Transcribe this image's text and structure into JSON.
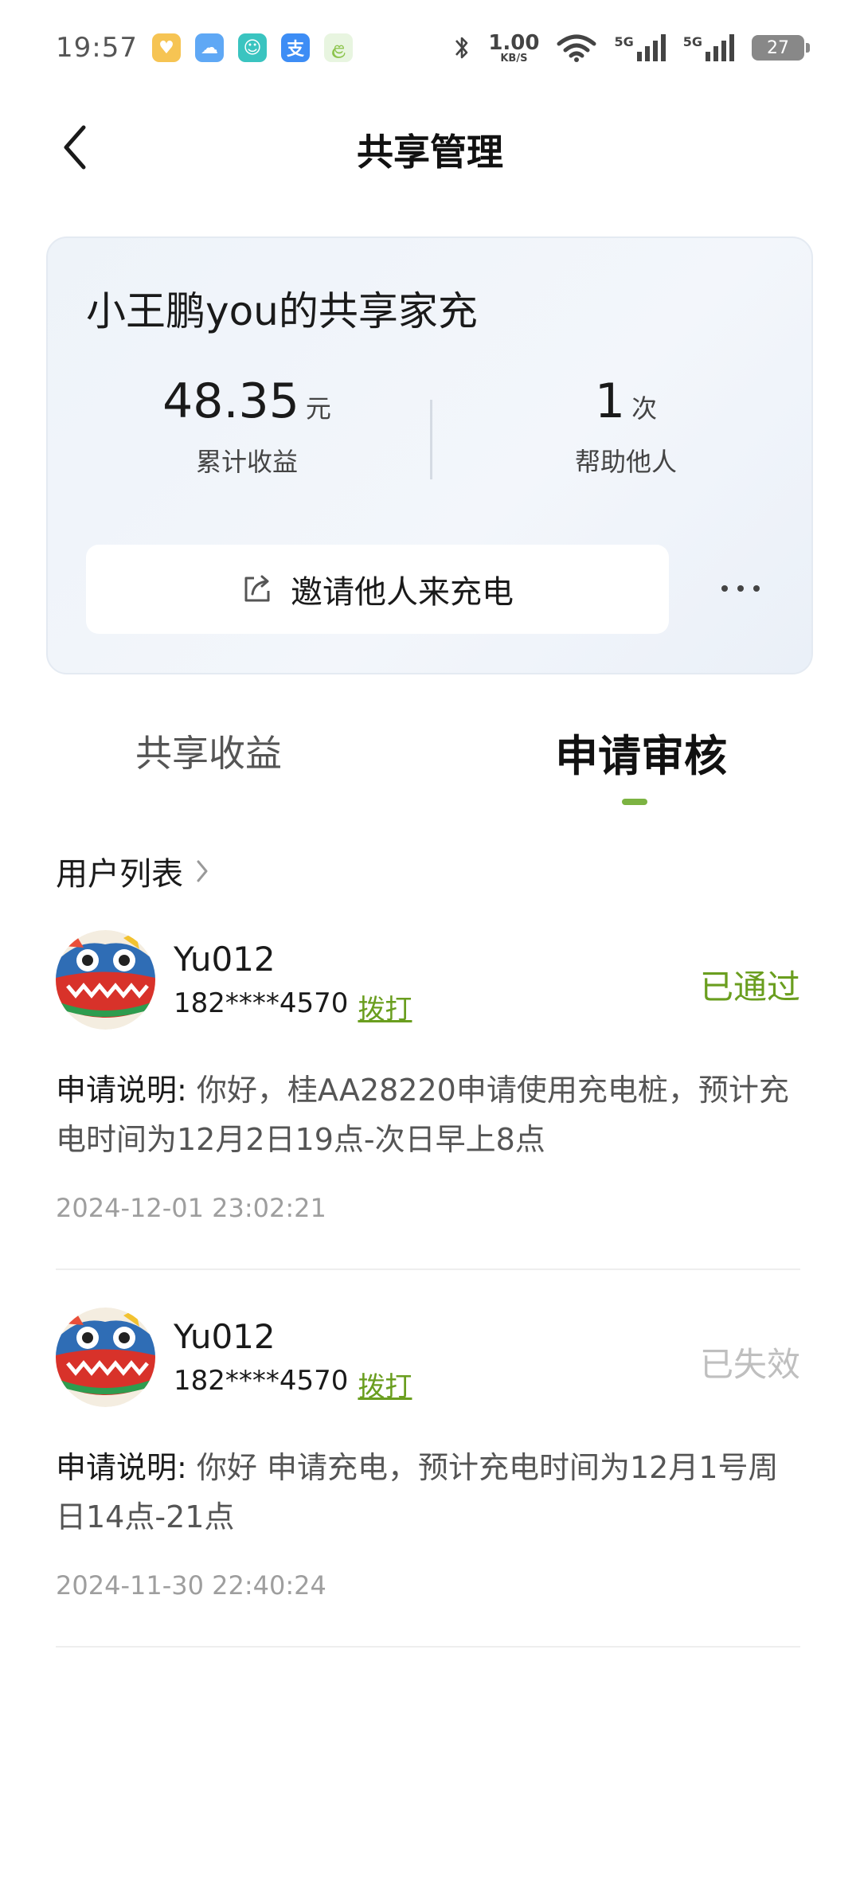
{
  "status_bar": {
    "time": "19:57",
    "app_icons": [
      {
        "name": "heart-app-icon",
        "color": "#f6c453",
        "glyph": "♥"
      },
      {
        "name": "cloud-app-icon",
        "color": "#5fa8f5",
        "glyph": "☁"
      },
      {
        "name": "cat-app-icon",
        "color": "#3ac4c0",
        "glyph": "☺"
      },
      {
        "name": "alipay-app-icon",
        "color": "#3d8df5",
        "glyph": "支"
      },
      {
        "name": "leaf-app-icon",
        "color": "#8bc34a",
        "glyph": "ළ"
      }
    ],
    "network_speed_value": "1.00",
    "network_speed_unit": "KB/S",
    "signal_label_1": "5G",
    "signal_label_2": "5G",
    "battery": "27"
  },
  "header": {
    "title": "共享管理"
  },
  "summary_card": {
    "title": "小王鹏you的共享家充",
    "earnings": {
      "value": "48.35",
      "unit": "元",
      "label": "累计收益"
    },
    "helped": {
      "value": "1",
      "unit": "次",
      "label": "帮助他人"
    },
    "invite_label": "邀请他人来充电"
  },
  "tabs": [
    {
      "label": "共享收益",
      "active": false
    },
    {
      "label": "申请审核",
      "active": true
    }
  ],
  "accent_color": "#7cb342",
  "user_list": {
    "label": "用户列表"
  },
  "applications": [
    {
      "username": "Yu012",
      "phone": "182****4570",
      "dial_label": "拨打",
      "status": "已通过",
      "status_type": "approved",
      "desc_label": "申请说明:",
      "description": " 你好，桂AA28220申请使用充电桩，预计充电时间为12月2日19点-次日早上8点",
      "time": "2024-12-01 23:02:21"
    },
    {
      "username": "Yu012",
      "phone": "182****4570",
      "dial_label": "拨打",
      "status": "已失效",
      "status_type": "expired",
      "desc_label": "申请说明:",
      "description": " 你好 申请充电，预计充电时间为12月1号周日14点-21点",
      "time": "2024-11-30 22:40:24"
    }
  ]
}
